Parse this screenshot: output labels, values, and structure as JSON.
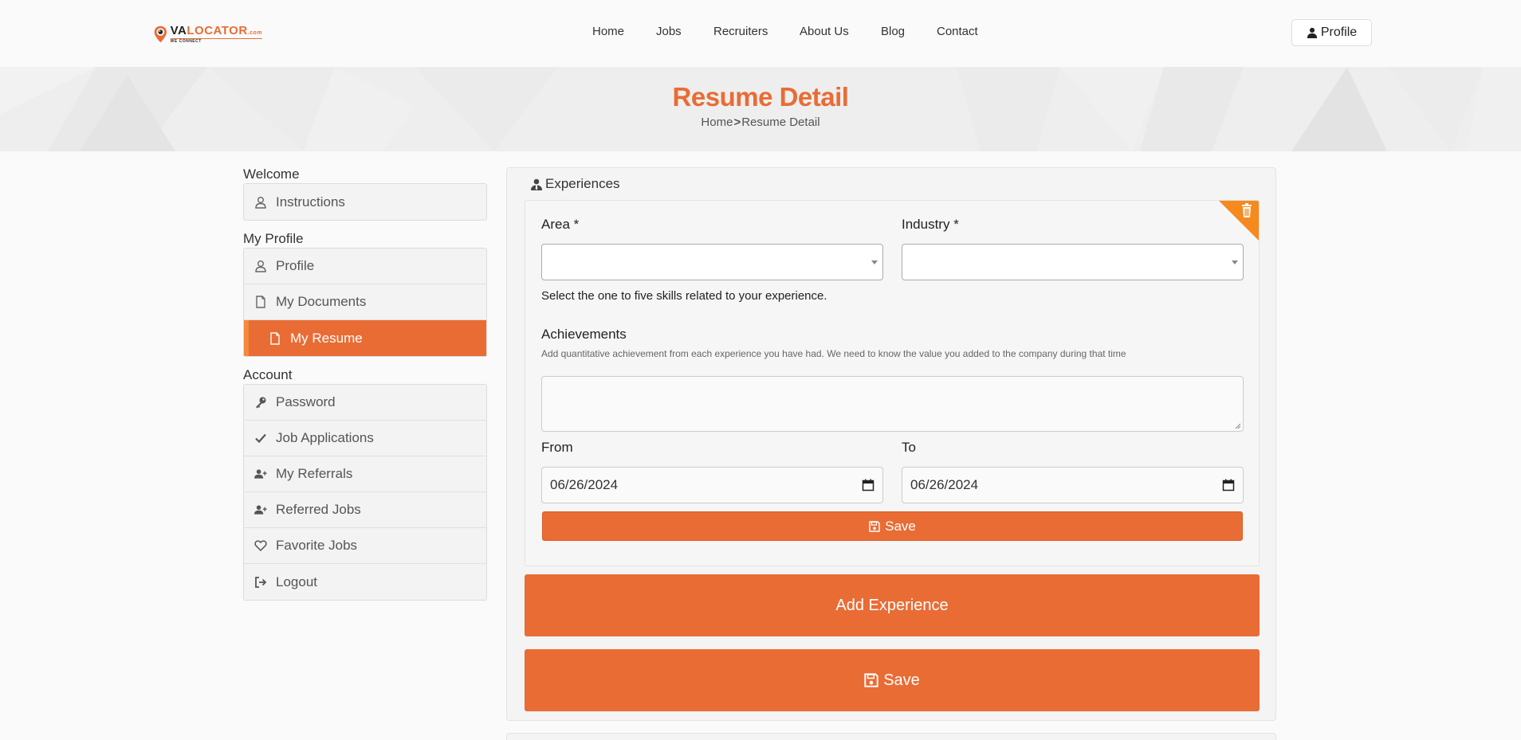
{
  "header": {
    "logo": {
      "name_part1": "VA",
      "name_part2": "LOCATOR",
      "name_suffix": ".com",
      "tagline": "WE CONNECT"
    },
    "nav": [
      "Home",
      "Jobs",
      "Recruiters",
      "About Us",
      "Blog",
      "Contact"
    ],
    "profile_button": "Profile"
  },
  "banner": {
    "title": "Resume Detail",
    "breadcrumb": {
      "home": "Home",
      "separator": ">",
      "current": "Resume Detail"
    }
  },
  "sidebar": {
    "sections": [
      {
        "heading": "Welcome",
        "items": [
          {
            "label": "Instructions",
            "icon": "user-outline-icon"
          }
        ]
      },
      {
        "heading": "My Profile",
        "items": [
          {
            "label": "Profile",
            "icon": "user-outline-icon"
          },
          {
            "label": "My Documents",
            "icon": "document-icon"
          },
          {
            "label": "My Resume",
            "icon": "document-icon",
            "active": true
          }
        ]
      },
      {
        "heading": "Account",
        "items": [
          {
            "label": "Password",
            "icon": "key-icon"
          },
          {
            "label": "Job Applications",
            "icon": "check-icon"
          },
          {
            "label": "My Referrals",
            "icon": "user-plus-icon"
          },
          {
            "label": "Referred Jobs",
            "icon": "user-plus-icon"
          },
          {
            "label": "Favorite Jobs",
            "icon": "heart-icon"
          },
          {
            "label": "Logout",
            "icon": "logout-icon"
          }
        ]
      }
    ]
  },
  "main": {
    "section_title": "Experiences",
    "experience_form": {
      "area_label": "Area *",
      "area_value": "",
      "industry_label": "Industry *",
      "industry_value": "",
      "skills_help": "Select the one to five skills related to your experience.",
      "achievements_label": "Achievements",
      "achievements_help": "Add quantitative achievement from each experience you have had. We need to know the value you added to the company during that time",
      "achievements_value": "",
      "from_label": "From",
      "from_value": "06/26/2024",
      "to_label": "To",
      "to_value": "06/26/2024",
      "save_label": "Save"
    },
    "add_experience_label": "Add Experience",
    "save_label": "Save"
  },
  "colors": {
    "accent": "#e96c35",
    "accent_light": "#f58a3c"
  }
}
